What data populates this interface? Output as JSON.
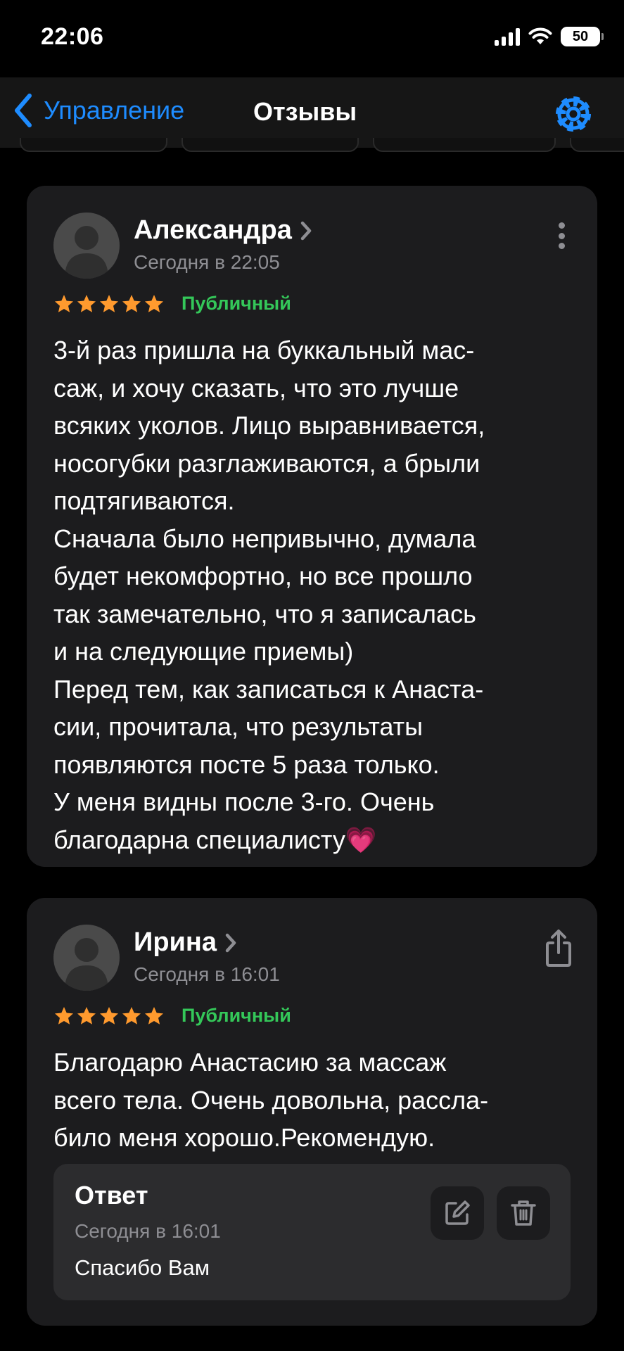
{
  "status_bar": {
    "time": "22:06",
    "battery": "50"
  },
  "nav": {
    "back_label": "Управление",
    "title": "Отзывы"
  },
  "colors": {
    "accent": "#1e8cff",
    "star": "#ff9a2e",
    "public_badge": "#34c759",
    "card": "#1c1c1e",
    "reply_box": "#2c2c2e"
  },
  "icons": {
    "back": "chevron-left-icon",
    "settings": "gear-icon",
    "more": "ellipsis-vertical-icon",
    "share": "share-icon",
    "edit": "edit-icon",
    "delete": "trash-icon"
  },
  "reviews": [
    {
      "author": "Александра",
      "date": "Сегодня в 22:05",
      "rating": 5,
      "visibility": "Публичный",
      "text": "3-й раз пришла на буккальный мас-\nсаж, и хочу сказать, что это лучше\nвсяких уколов. Лицо выравнивается,\nносогубки разглаживаются, а брыли\nподтягиваются.\nСначала было непривычно, думала\nбудет некомфортно, но все прошло\nтак замечательно, что я записалась\nи на следующие приемы)\nПеред тем, как записаться к Анаста-\nсии, прочитала, что результаты\nпоявляются посте 5 раза только.\nУ меня видны после 3-го. Очень\nблагодарна специалисту💗"
    },
    {
      "author": "Ирина",
      "date": "Сегодня в 16:01",
      "rating": 5,
      "visibility": "Публичный",
      "text": "Благодарю Анастасию за массаж\nвсего тела. Очень довольна, рассла-\nбило меня хорошо.Рекомендую.",
      "reply": {
        "title": "Ответ",
        "date": "Сегодня в 16:01",
        "text": "Спасибо Вам"
      }
    }
  ]
}
